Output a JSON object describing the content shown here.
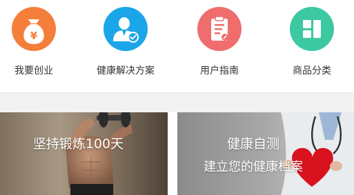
{
  "colors": {
    "orange": "#f57e3a",
    "blue": "#1aa6e8",
    "red": "#f06d6d",
    "green": "#3cc8a0",
    "divider": "#f2f2f2",
    "text": "#333333"
  },
  "icons": [
    {
      "label": "我要创业",
      "icon": "money-bag-icon",
      "symbol": "¥",
      "color": "#f57e3a"
    },
    {
      "label": "健康解决方案",
      "icon": "user-check-icon",
      "color": "#1aa6e8"
    },
    {
      "label": "用户指南",
      "icon": "clipboard-icon",
      "color": "#f06d6d"
    },
    {
      "label": "商品分类",
      "icon": "grid-icon",
      "color": "#3cc8a0"
    }
  ],
  "banners": {
    "left": {
      "title": "坚持锻炼100天"
    },
    "right": {
      "title": "健康自测",
      "subtitle": "建立您的健康档案"
    }
  }
}
